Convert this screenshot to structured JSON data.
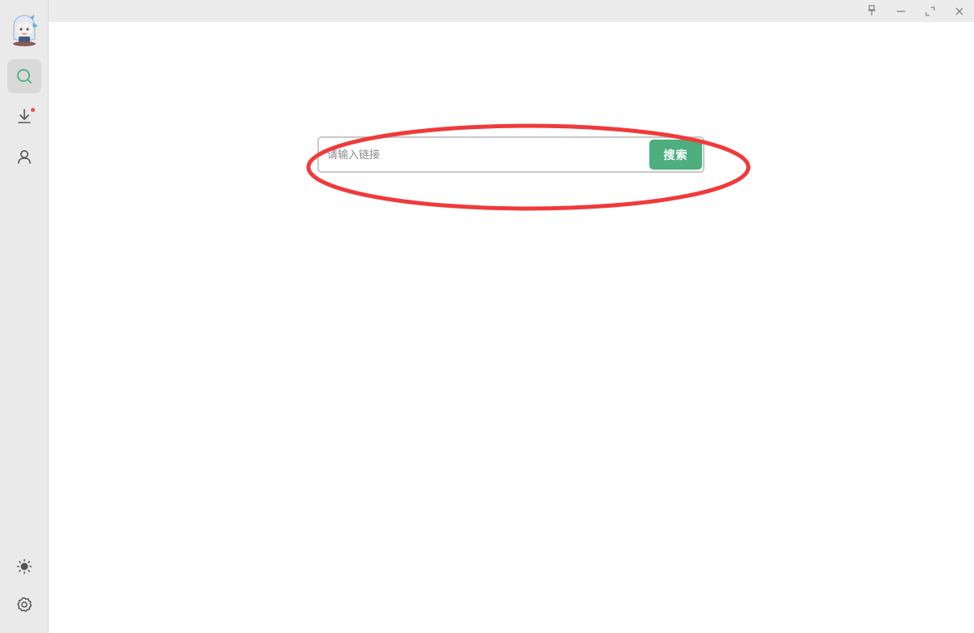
{
  "window": {
    "controls": [
      {
        "name": "pin-icon"
      },
      {
        "name": "minimize-icon"
      },
      {
        "name": "maximize-icon"
      },
      {
        "name": "close-icon"
      }
    ]
  },
  "sidebar": {
    "items": [
      {
        "name": "search",
        "icon": "search-icon",
        "active": true
      },
      {
        "name": "download",
        "icon": "download-icon",
        "has_badge": true
      },
      {
        "name": "user",
        "icon": "user-icon"
      }
    ],
    "bottom_items": [
      {
        "name": "theme",
        "icon": "sun-icon"
      },
      {
        "name": "settings",
        "icon": "gear-icon"
      }
    ]
  },
  "search": {
    "placeholder": "请输入链接",
    "value": "",
    "button_label": "搜索"
  },
  "colors": {
    "accent": "#4caf7d",
    "sidebar_bg": "#eaeaea",
    "titlebar_bg": "#ececec",
    "badge": "#f04a4a",
    "annotation": "#f03a3a"
  }
}
